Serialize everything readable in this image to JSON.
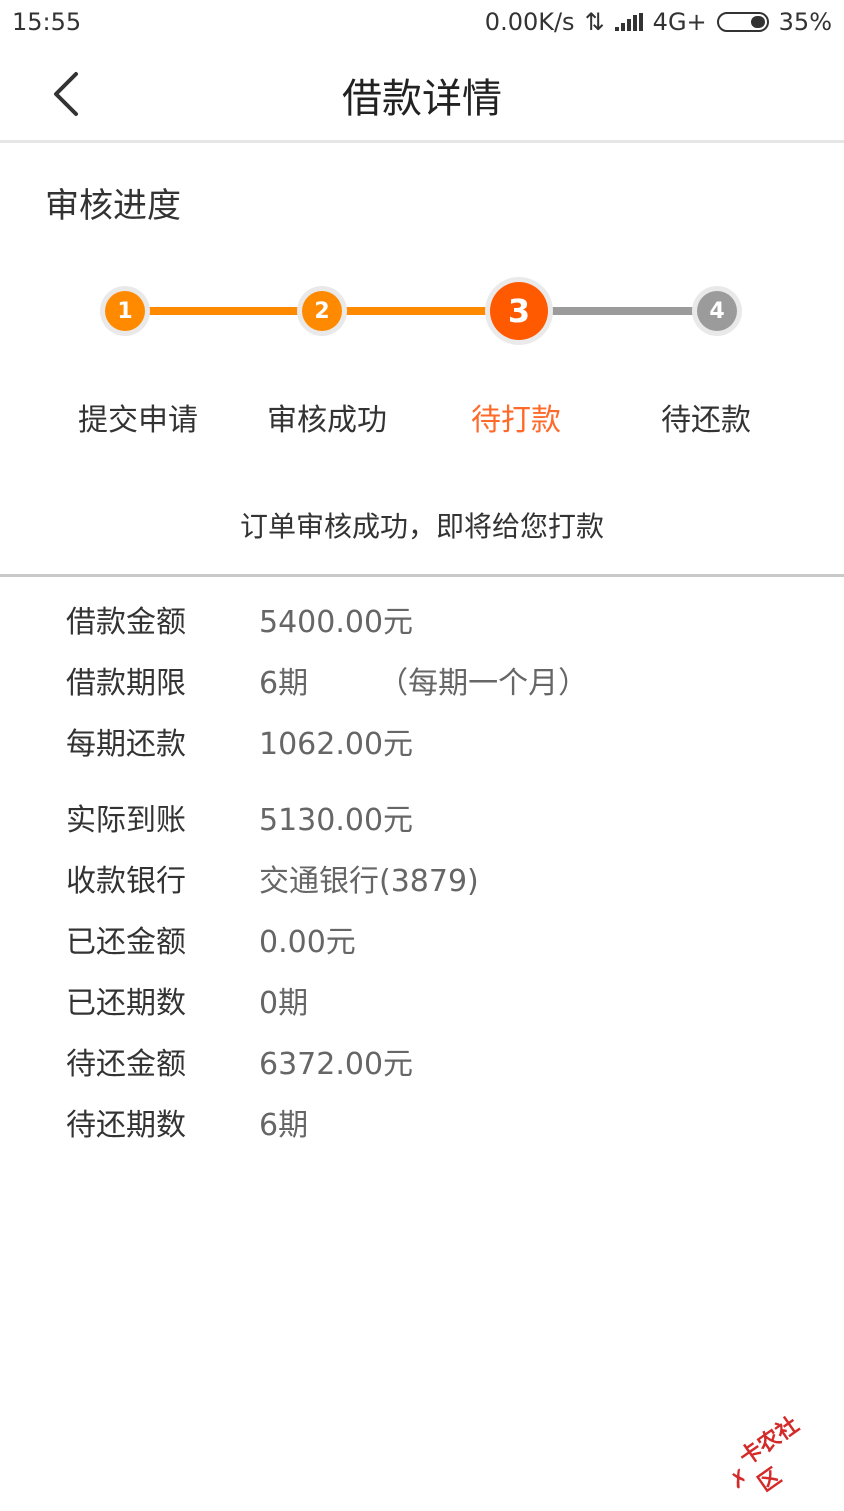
{
  "status_bar": {
    "time": "15:55",
    "speed": "0.00K/s",
    "network": "4G+",
    "battery": "35%"
  },
  "header": {
    "title": "借款详情"
  },
  "progress": {
    "title": "审核进度",
    "steps": [
      {
        "number": "1",
        "label": "提交申请",
        "state": "done"
      },
      {
        "number": "2",
        "label": "审核成功",
        "state": "done"
      },
      {
        "number": "3",
        "label": "待打款",
        "state": "current"
      },
      {
        "number": "4",
        "label": "待还款",
        "state": "pending"
      }
    ],
    "notice": "订单审核成功，即将给您打款"
  },
  "details": [
    {
      "label": "借款金额",
      "value": "5400.00元"
    },
    {
      "label": "借款期限",
      "value": "6期",
      "note": "（每期一个月）"
    },
    {
      "label": "每期还款",
      "value": "1062.00元"
    },
    {
      "label": "实际到账",
      "value": "5130.00元"
    },
    {
      "label": "收款银行",
      "value": "交通银行(3879)"
    },
    {
      "label": "已还金额",
      "value": "0.00元"
    },
    {
      "label": "已还期数",
      "value": "0期"
    },
    {
      "label": "待还金额",
      "value": "6372.00元"
    },
    {
      "label": "待还期数",
      "value": "6期"
    }
  ],
  "watermark": {
    "text": "卡农社区"
  },
  "colors": {
    "accent": "#ff8a00",
    "current": "#ff5a00",
    "pending": "#9b9b9b",
    "active_label": "#ff6a2a"
  }
}
